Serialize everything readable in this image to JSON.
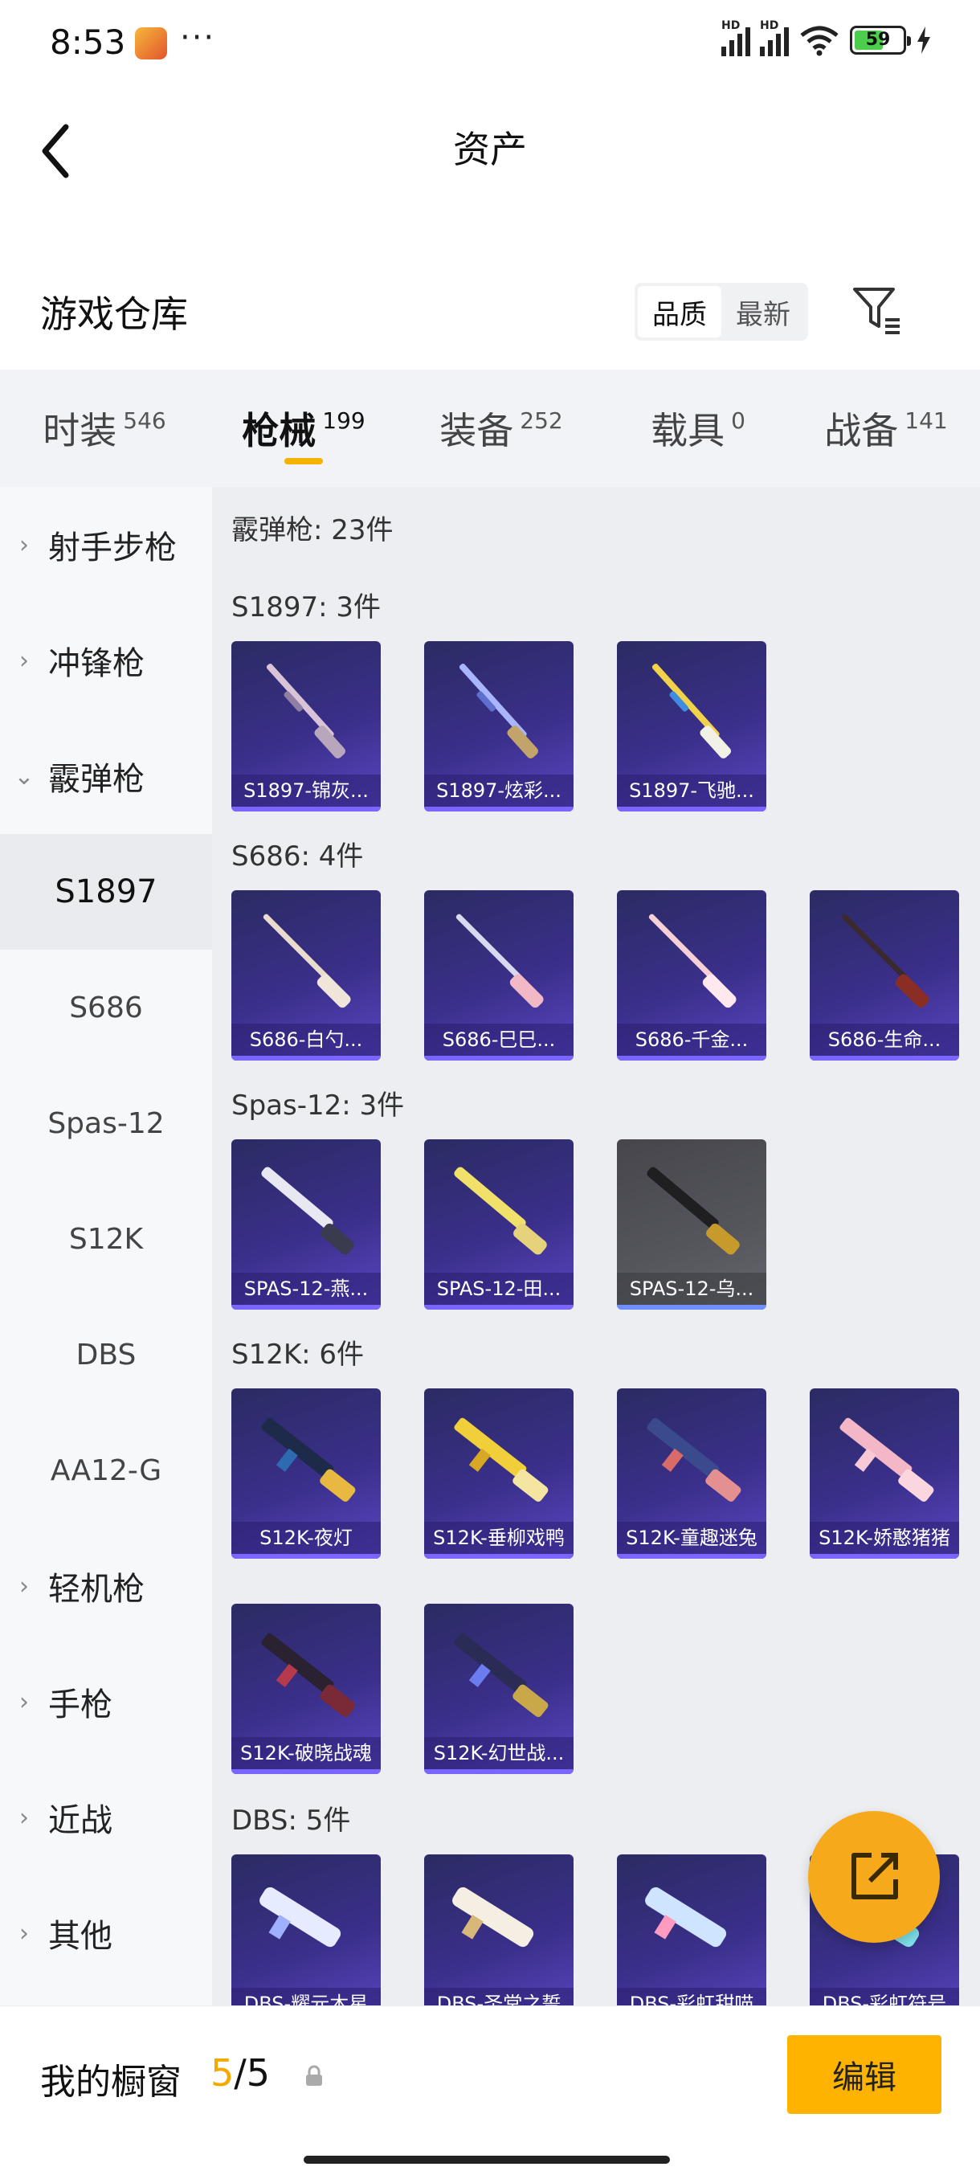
{
  "status_bar": {
    "time": "8:53",
    "more": "···",
    "battery": "59",
    "hd1": "HD",
    "hd2": "HD"
  },
  "header": {
    "title": "资产"
  },
  "section": {
    "title": "游戏仓库",
    "sort_options": [
      "品质",
      "最新"
    ],
    "sort_selected": "品质"
  },
  "category_tabs": [
    {
      "label": "时装",
      "count": "546"
    },
    {
      "label": "枪械",
      "count": "199",
      "active": true
    },
    {
      "label": "装备",
      "count": "252"
    },
    {
      "label": "载具",
      "count": "0"
    },
    {
      "label": "战备",
      "count": "141"
    }
  ],
  "sidebar": [
    {
      "label": "射手步枪",
      "type": "group",
      "expanded": false
    },
    {
      "label": "冲锋枪",
      "type": "group",
      "expanded": false
    },
    {
      "label": "霰弹枪",
      "type": "group",
      "expanded": true
    },
    {
      "label": "S1897",
      "type": "sub",
      "selected": true
    },
    {
      "label": "S686",
      "type": "sub"
    },
    {
      "label": "Spas-12",
      "type": "sub"
    },
    {
      "label": "S12K",
      "type": "sub"
    },
    {
      "label": "DBS",
      "type": "sub"
    },
    {
      "label": "AA12-G",
      "type": "sub"
    },
    {
      "label": "轻机枪",
      "type": "group",
      "expanded": false
    },
    {
      "label": "手枪",
      "type": "group",
      "expanded": false
    },
    {
      "label": "近战",
      "type": "group",
      "expanded": false
    },
    {
      "label": "其他",
      "type": "group",
      "expanded": false
    }
  ],
  "content": {
    "summary": "霰弹枪: 23件",
    "groups": [
      {
        "label": "S1897: 3件",
        "items": [
          "S1897-锦灰...",
          "S1897-炫彩...",
          "S1897-飞驰..."
        ]
      },
      {
        "label": "S686: 4件",
        "items": [
          "S686-白勺...",
          "S686-巳巳...",
          "S686-千金...",
          "S686-生命..."
        ]
      },
      {
        "label": "Spas-12: 3件",
        "items": [
          "SPAS-12-燕...",
          "SPAS-12-田...",
          "SPAS-12-乌..."
        ]
      },
      {
        "label": "S12K: 6件",
        "items": [
          "S12K-夜灯",
          "S12K-垂柳戏鸭",
          "S12K-童趣迷兔",
          "S12K-娇憨猪猪",
          "S12K-破晓战魂",
          "S12K-幻世战..."
        ]
      },
      {
        "label": "DBS: 5件",
        "items": [
          "DBS-耀元木星",
          "DBS-圣堂之誓",
          "DBS-彩虹甜喵",
          "DBS-彩虹符号"
        ]
      }
    ]
  },
  "bottom_bar": {
    "label": "我的橱窗",
    "current": "5",
    "separator": "/",
    "total": "5",
    "edit": "编辑"
  },
  "colors": {
    "accent": "#fdb300",
    "card_purple": "#3a2f8a",
    "fab": "#f6a91b"
  }
}
